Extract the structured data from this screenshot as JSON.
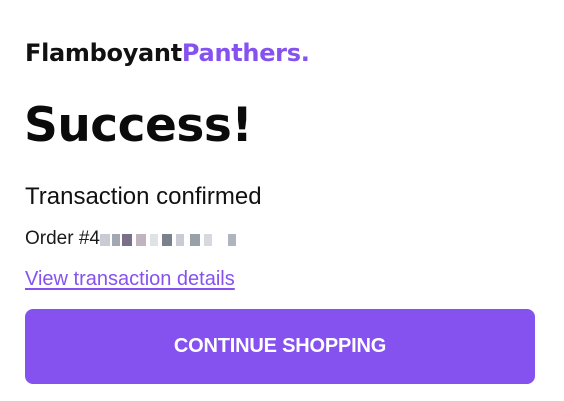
{
  "brand": {
    "name_part1": "Flamboyant",
    "name_part2": "Panthers."
  },
  "headline": "Success!",
  "subheadline": "Transaction confirmed",
  "order": {
    "label": "Order #4"
  },
  "links": {
    "view_details": "View transaction details"
  },
  "buttons": {
    "continue": "CONTINUE SHOPPING"
  },
  "colors": {
    "accent": "#8552ef",
    "text": "#111111",
    "background": "#ffffff"
  }
}
